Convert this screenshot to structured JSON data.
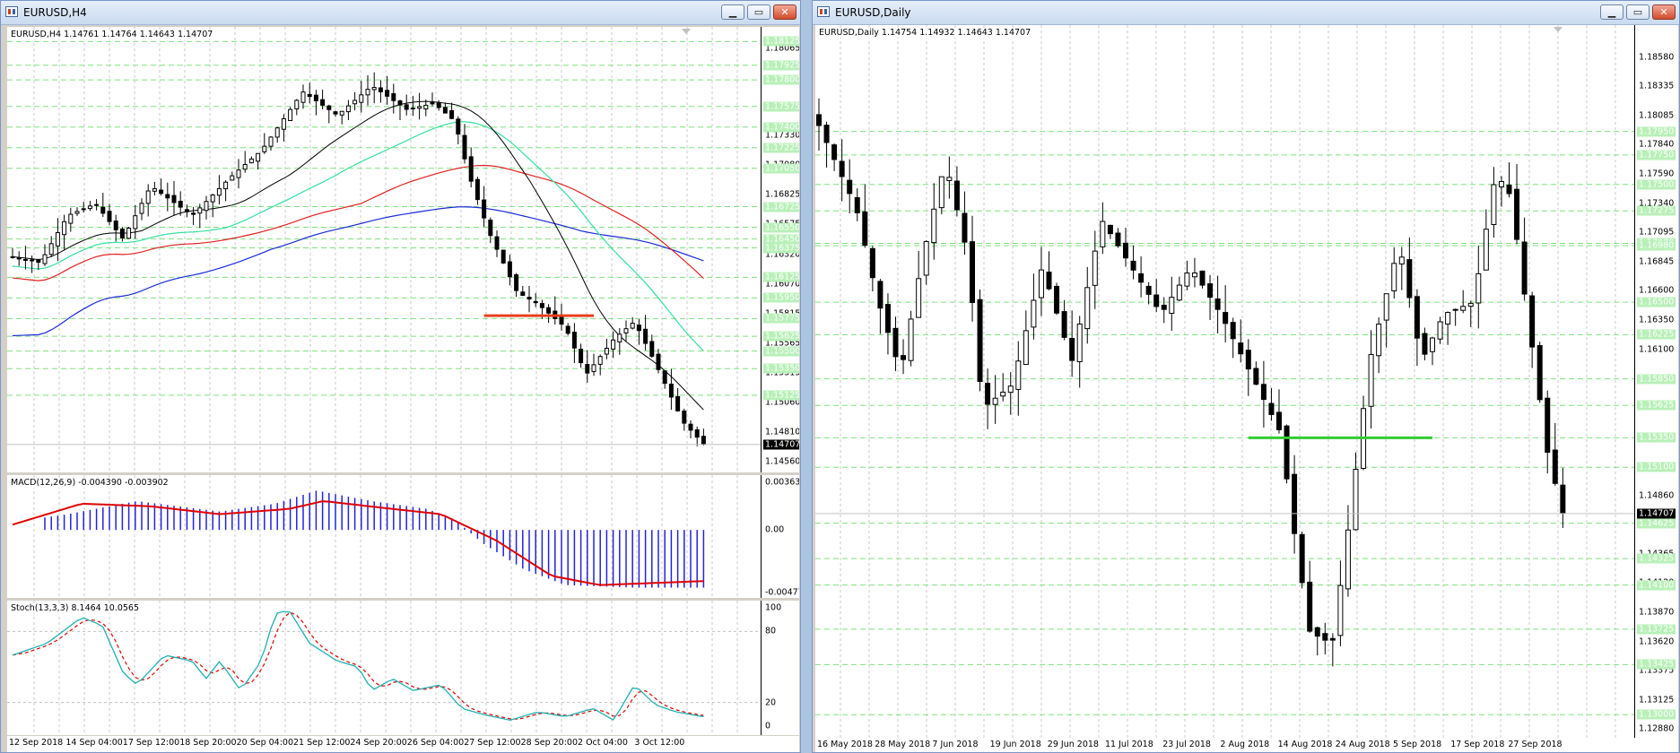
{
  "left_window": {
    "title": "EURUSD,H4",
    "price_label": "EURUSD,H4  1.14761 1.14764 1.14643 1.14707",
    "price_axis": [
      "1.18065",
      "1.17925",
      "1.17800",
      "1.17575",
      "1.17330",
      "1.17080",
      "1.16825",
      "1.16575",
      "1.16320",
      "1.16070",
      "1.15815",
      "1.15565",
      "1.15315",
      "1.15060",
      "1.14810",
      "1.14560"
    ],
    "green_levels": [
      "1.18125",
      "1.17925",
      "1.17800",
      "1.17575",
      "1.17400",
      "1.17225",
      "1.17050",
      "1.16725",
      "1.16550",
      "1.16450",
      "1.16375",
      "1.16125",
      "1.15950",
      "1.15775",
      "1.15625",
      "1.15500",
      "1.15350",
      "1.15125"
    ],
    "current_price": "1.14707",
    "macd_label": "MACD(12,26,9) -0.004390 -0.003902",
    "macd_axis": [
      "0.003631",
      "0.00",
      "-0.004772"
    ],
    "stoch_label": "Stoch(13,3,3) 8.1464 10.0565",
    "stoch_axis": [
      "100",
      "80",
      "20",
      "0"
    ],
    "time_axis": [
      "12 Sep 2018",
      "14 Sep 04:00",
      "17 Sep 12:00",
      "18 Sep 20:00",
      "20 Sep 04:00",
      "21 Sep 12:00",
      "24 Sep 20:00",
      "26 Sep 04:00",
      "27 Sep 12:00",
      "28 Sep 20:00",
      "2 Oct 04:00",
      "3 Oct 12:00"
    ]
  },
  "right_window": {
    "title": "EURUSD,Daily",
    "price_label": "EURUSD,Daily  1.14754 1.14932 1.14643 1.14707",
    "price_axis": [
      "1.18580",
      "1.18335",
      "1.18085",
      "1.17840",
      "1.17590",
      "1.17340",
      "1.17095",
      "1.16845",
      "1.16600",
      "1.16350",
      "1.16100",
      "1.15855",
      "1.15605",
      "1.15355",
      "1.15110",
      "1.14860",
      "1.14615",
      "1.14365",
      "1.14120",
      "1.13870",
      "1.13620",
      "1.13375",
      "1.13125",
      "1.12880"
    ],
    "green_levels": [
      "1.17950",
      "1.17750",
      "1.17500",
      "1.17275",
      "1.17000",
      "1.16980",
      "1.16500",
      "1.16225",
      "1.15850",
      "1.15625",
      "1.15350",
      "1.15100",
      "1.14625",
      "1.14325",
      "1.14100",
      "1.13725",
      "1.13425",
      "1.13000"
    ],
    "current_price": "1.14707",
    "time_axis": [
      "16 May 2018",
      "28 May 2018",
      "7 Jun 2018",
      "19 Jun 2018",
      "29 Jun 2018",
      "11 Jul 2018",
      "23 Jul 2018",
      "2 Aug 2018",
      "14 Aug 2018",
      "24 Aug 2018",
      "5 Sep 2018",
      "17 Sep 2018",
      "27 Sep 2018"
    ]
  },
  "colors": {
    "grid": "#c8c8c8",
    "green_level": "#7fe07f",
    "support": "#33cc33",
    "resistance": "#e8401c",
    "ma_black": "#000000",
    "ma_aqua": "#33e0a0",
    "ma_red": "#e02020",
    "ma_blue": "#1a2ad8",
    "macd_hist": "#2222dd",
    "macd_signal": "#e00000",
    "stoch_main": "#20b0b0",
    "stoch_signal": "#e00000"
  }
}
